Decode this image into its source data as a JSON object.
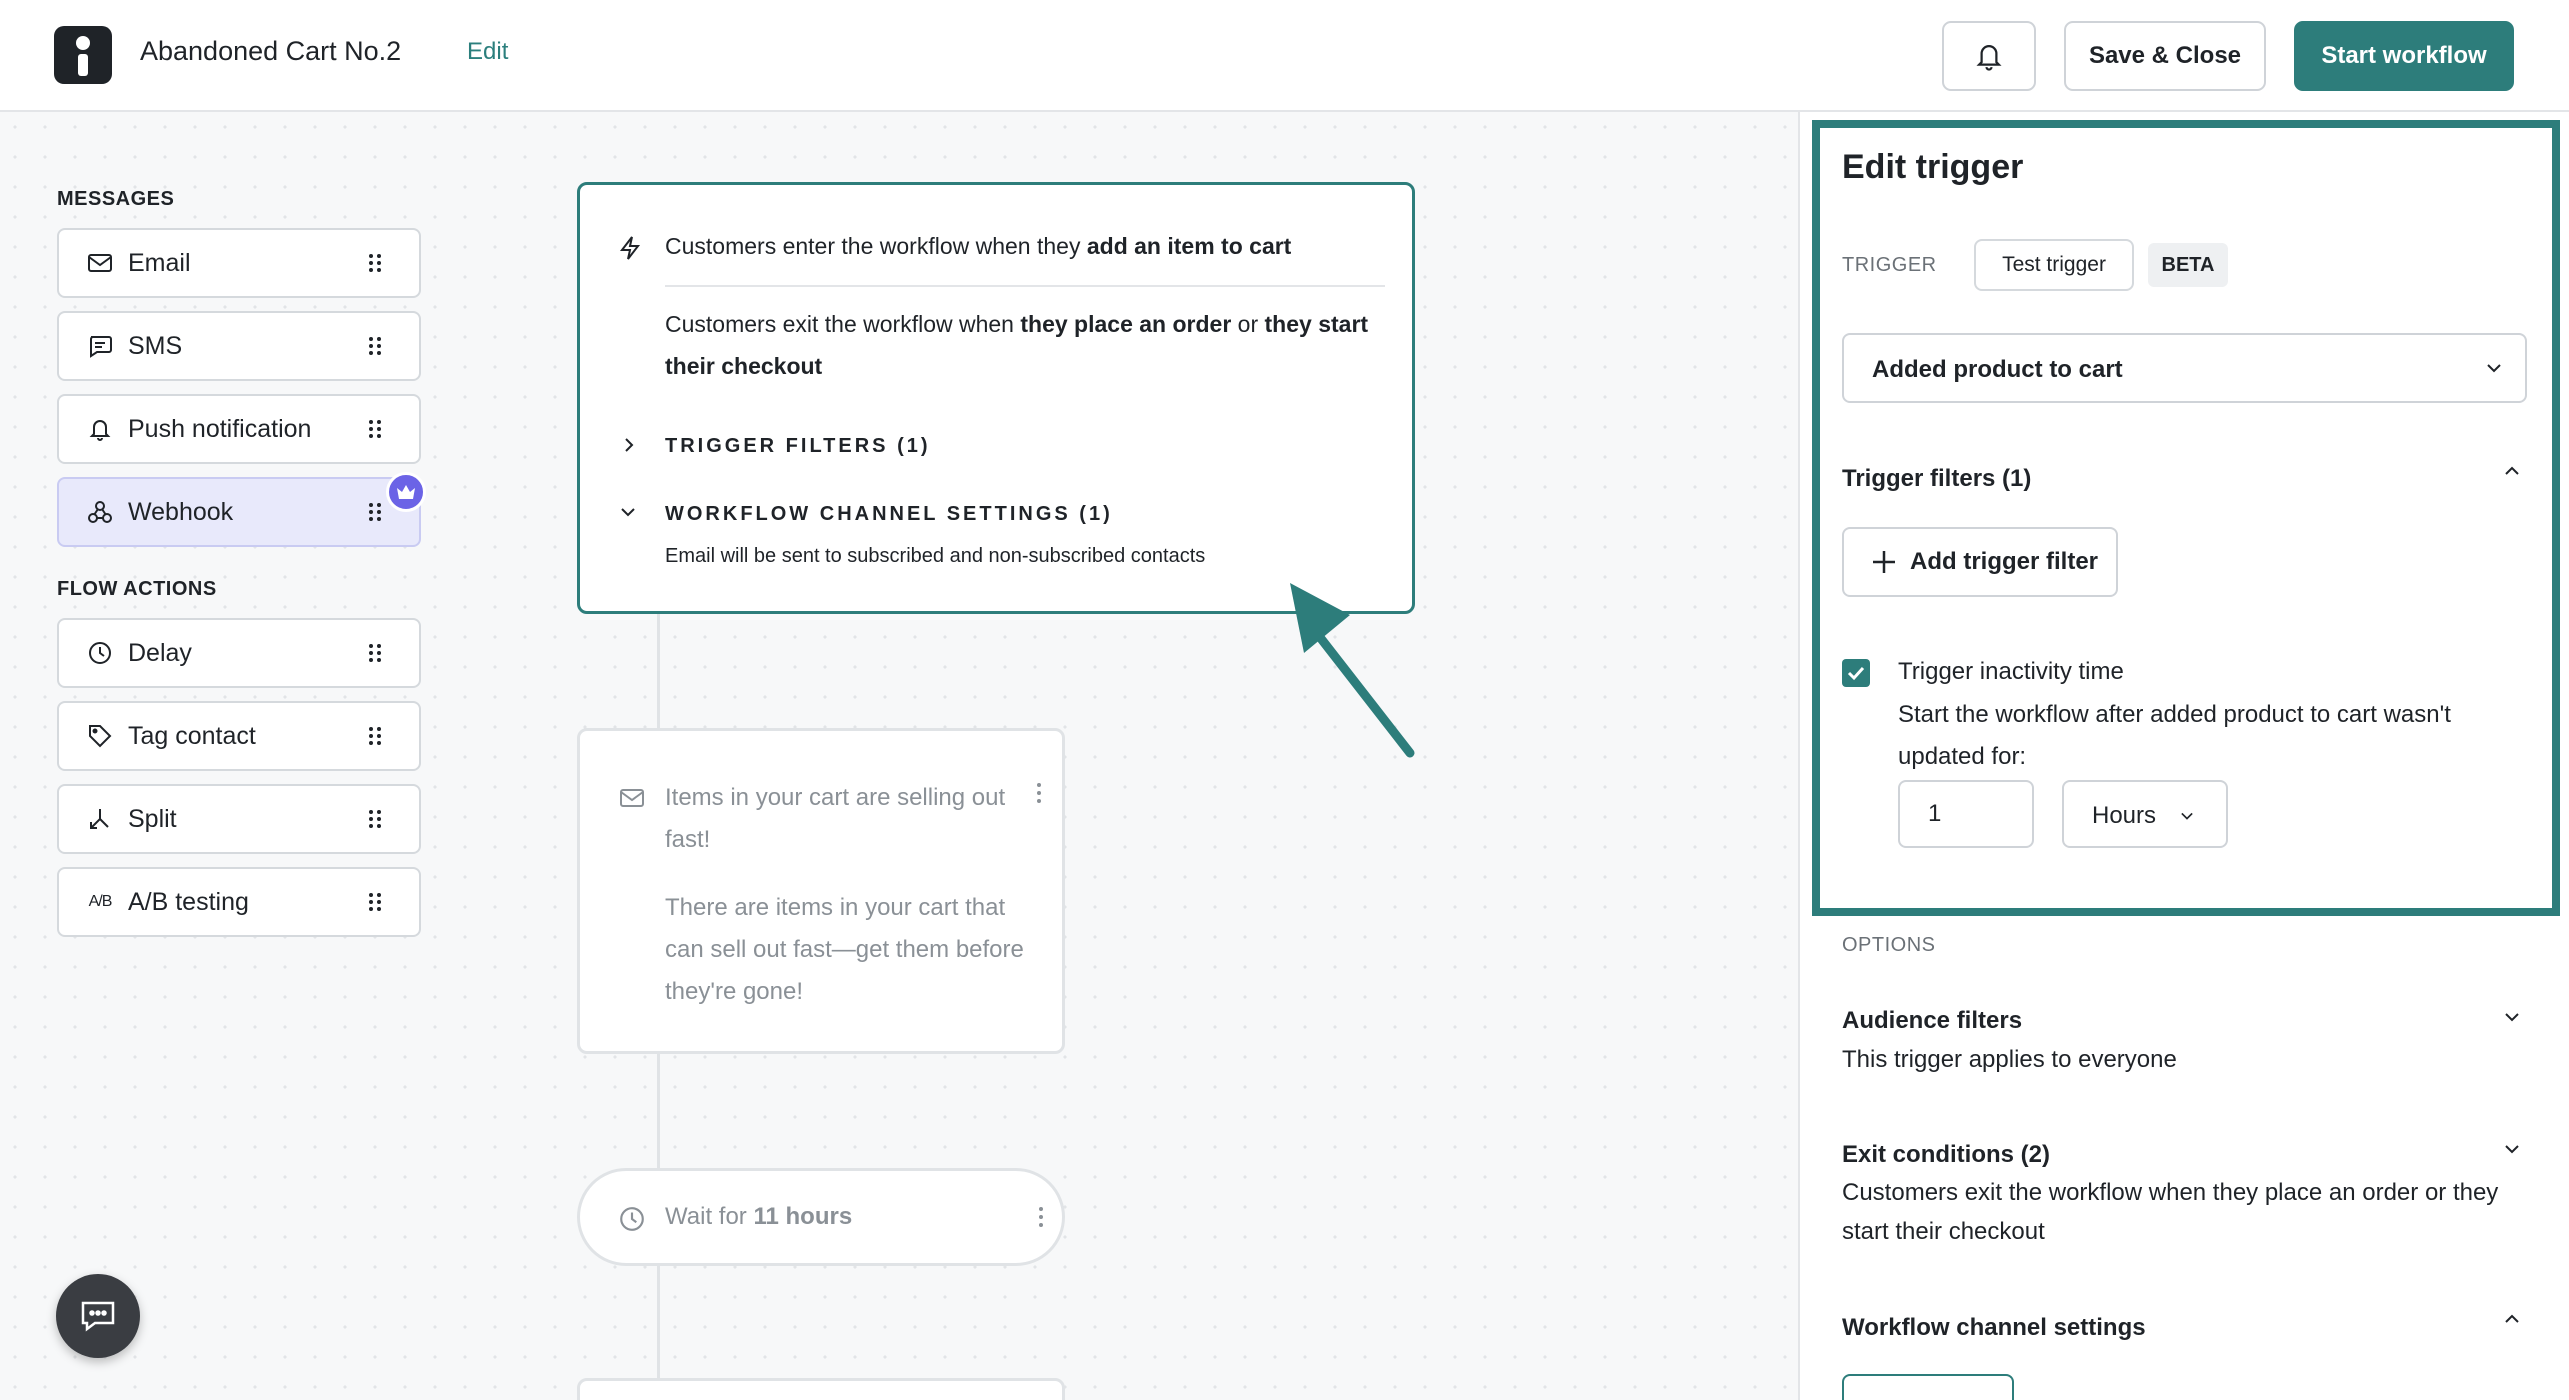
{
  "header": {
    "title": "Abandoned Cart No.2",
    "edit_label": "Edit",
    "save_close_label": "Save & Close",
    "start_label": "Start workflow"
  },
  "palette": {
    "messages_label": "MESSAGES",
    "messages": [
      {
        "label": "Email",
        "icon": "mail-icon"
      },
      {
        "label": "SMS",
        "icon": "chat-bubble-icon"
      },
      {
        "label": "Push notification",
        "icon": "bell-icon"
      },
      {
        "label": "Webhook",
        "icon": "webhook-icon"
      }
    ],
    "flow_actions_label": "FLOW ACTIONS",
    "actions": [
      {
        "label": "Delay",
        "icon": "clock-icon"
      },
      {
        "label": "Tag contact",
        "icon": "tag-icon"
      },
      {
        "label": "Split",
        "icon": "split-icon"
      },
      {
        "label": "A/B testing",
        "icon": "ab-icon"
      }
    ]
  },
  "trigger_card": {
    "enter_prefix": "Customers enter the workflow when they ",
    "enter_bold": "add an item to cart",
    "exit_prefix": "Customers exit the workflow when ",
    "exit_bold1": "they place an order",
    "exit_mid": " or ",
    "exit_bold2": "they start their checkout",
    "filters_label": "TRIGGER FILTERS (1)",
    "channel_label": "WORKFLOW CHANNEL SETTINGS (1)",
    "channel_desc": "Email will be sent to subscribed and non-subscribed contacts"
  },
  "message_card": {
    "title": "Items in your cart are selling out fast!",
    "body": "There are items in your cart that can sell out fast—get them before they're gone!"
  },
  "wait_card": {
    "prefix": "Wait for ",
    "bold": "11 hours"
  },
  "panel": {
    "title": "Edit trigger",
    "trigger_label": "TRIGGER",
    "test_trigger_label": "Test trigger",
    "beta_label": "BETA",
    "trigger_value": "Added product to cart",
    "filters_title": "Trigger filters (1)",
    "add_filter_label": "Add trigger filter",
    "inactivity_title": "Trigger inactivity time",
    "inactivity_desc": "Start the workflow after added product to cart wasn't updated for:",
    "inactivity_value": "1",
    "inactivity_unit": "Hours",
    "options_label": "OPTIONS",
    "audience_title": "Audience filters",
    "audience_desc": "This trigger applies to everyone",
    "exit_title": "Exit conditions (2)",
    "exit_desc": "Customers exit the workflow when they place an order or they start their checkout",
    "channel_title": "Workflow channel settings"
  },
  "colors": {
    "accent": "#2d7d7b",
    "webhook_selected_bg": "#e8e9fb",
    "crown_badge": "#6b63e6"
  }
}
